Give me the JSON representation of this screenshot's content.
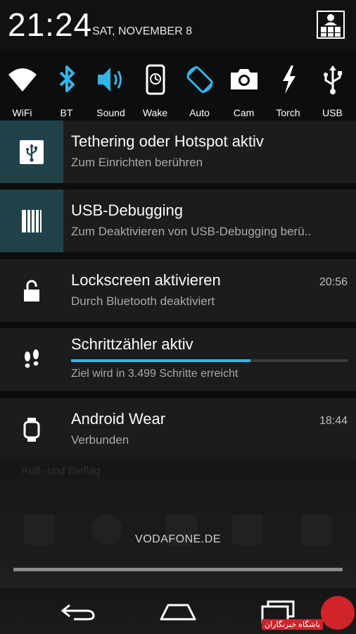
{
  "status": {
    "time": "21:24",
    "date": "SAT, NOVEMBER 8"
  },
  "quick_settings": [
    {
      "label": "WiFi",
      "icon": "wifi-icon"
    },
    {
      "label": "BT",
      "icon": "bluetooth-icon"
    },
    {
      "label": "Sound",
      "icon": "volume-icon"
    },
    {
      "label": "Wake",
      "icon": "wake-phone-icon"
    },
    {
      "label": "Auto",
      "icon": "auto-rotate-icon"
    },
    {
      "label": "Cam",
      "icon": "camera-icon"
    },
    {
      "label": "Torch",
      "icon": "flashlight-icon"
    },
    {
      "label": "USB",
      "icon": "usb-icon"
    }
  ],
  "notifications": [
    {
      "title": "Tethering oder Hotspot aktiv",
      "subtitle": "Zum Einrichten berühren",
      "time": "",
      "icon": "usb-icon"
    },
    {
      "title": "USB-Debugging",
      "subtitle": "Zum Deaktivieren von USB-Debugging berü..",
      "time": "",
      "icon": "debug-icon"
    },
    {
      "title": "Lockscreen aktivieren",
      "subtitle": "Durch Bluetooth deaktiviert",
      "time": "20:56",
      "icon": "unlock-icon"
    },
    {
      "title": "Schrittzähler aktiv",
      "subtitle": "Ziel wird in 3.499 Schritte erreicht",
      "time": "",
      "icon": "footsteps-icon",
      "progress": 0.65
    },
    {
      "title": "Android Wear",
      "subtitle": "Verbunden",
      "time": "18:44",
      "icon": "watch-icon"
    }
  ],
  "background": {
    "ghost_text": "Ruß- und Einflag"
  },
  "carrier": "VODAFONE.DE",
  "watermark": {
    "text": "باشگاه خبرنگاران"
  },
  "colors": {
    "accent": "#33b5e5",
    "teal_icon_bg": "#22424a",
    "notification_bg": "#1b1c1e"
  }
}
